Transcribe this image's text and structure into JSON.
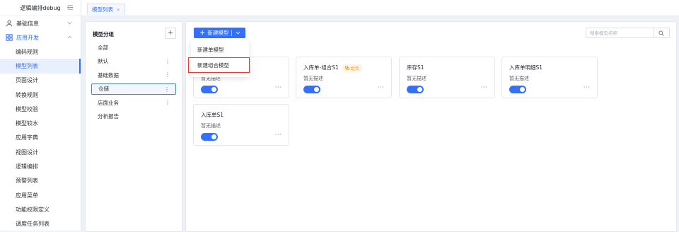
{
  "app": {
    "title": "逻辑编排debug"
  },
  "sidebar": {
    "groups": [
      {
        "label": "基础信息",
        "icon": "user-icon"
      },
      {
        "label": "应用开发",
        "icon": "apps-icon"
      }
    ],
    "items": [
      {
        "label": "编码规则"
      },
      {
        "label": "模型列表"
      },
      {
        "label": "页面设计"
      },
      {
        "label": "转换规则"
      },
      {
        "label": "模型校验"
      },
      {
        "label": "模型较水"
      },
      {
        "label": "应用字典"
      },
      {
        "label": "视图设计"
      },
      {
        "label": "逻辑编排"
      },
      {
        "label": "预警列表"
      },
      {
        "label": "应用菜单"
      },
      {
        "label": "功能权限定义"
      },
      {
        "label": "调度任务列表"
      }
    ],
    "active_item": "模型列表"
  },
  "tabs": [
    {
      "label": "模型列表",
      "close": "×"
    }
  ],
  "group_panel": {
    "title": "模型分组",
    "add_label": "+",
    "items": [
      {
        "label": "全部",
        "more": ""
      },
      {
        "label": "默认",
        "more": "⋮"
      },
      {
        "label": "基础数据",
        "more": "⋮"
      },
      {
        "label": "仓储",
        "more": "⋮"
      },
      {
        "label": "店面业务",
        "more": "⋮"
      },
      {
        "label": "分析报告",
        "more": ""
      }
    ],
    "selected": "仓储"
  },
  "toolbar": {
    "new_button_label": "新建模型",
    "search_placeholder": "搜索模型名称"
  },
  "dropdown": {
    "items": [
      {
        "label": "新建单模型"
      },
      {
        "label": "新建组合模型"
      }
    ]
  },
  "cards": [
    {
      "name": "",
      "desc": "暂无描述",
      "badge": "",
      "enabled": true,
      "more": "···"
    },
    {
      "name": "入库单-组合S1",
      "desc": "暂无描述",
      "badge": "组合",
      "enabled": true,
      "more": "···"
    },
    {
      "name": "库存S1",
      "desc": "暂无描述",
      "badge": "",
      "enabled": true,
      "more": "···"
    },
    {
      "name": "入库单明细S1",
      "desc": "暂无描述",
      "badge": "",
      "enabled": true,
      "more": "···"
    },
    {
      "name": "入库单S1",
      "desc": "暂无描述",
      "badge": "",
      "enabled": true,
      "more": "···"
    }
  ],
  "colors": {
    "primary": "#3370ff",
    "highlight_border": "#e53935",
    "badge": "#f59a23"
  }
}
